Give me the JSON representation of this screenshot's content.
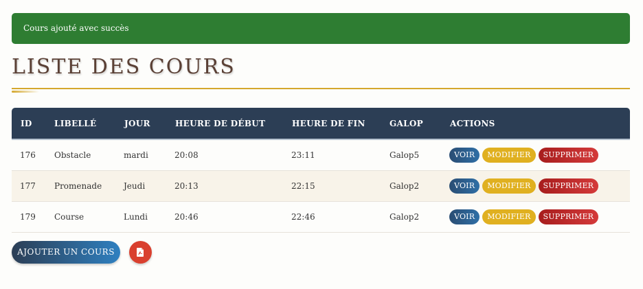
{
  "alert": {
    "message": "Cours ajouté avec succès",
    "color": "#2e7d32"
  },
  "page_title": "LISTE DES COURS",
  "table": {
    "headers": [
      "ID",
      "LIBELLÉ",
      "JOUR",
      "HEURE DE DÉBUT",
      "HEURE DE FIN",
      "GALOP",
      "ACTIONS"
    ],
    "rows": [
      {
        "id": "176",
        "libelle": "Obstacle",
        "jour": "mardi",
        "debut": "20:08",
        "fin": "23:11",
        "galop": "Galop5"
      },
      {
        "id": "177",
        "libelle": "Promenade",
        "jour": "Jeudi",
        "debut": "20:13",
        "fin": "22:15",
        "galop": "Galop2"
      },
      {
        "id": "179",
        "libelle": "Course",
        "jour": "Lundi",
        "debut": "20:46",
        "fin": "22:46",
        "galop": "Galop2"
      }
    ],
    "actions": {
      "view": "VOIR",
      "edit": "MODIFIER",
      "delete": "SUPPRIMER"
    }
  },
  "buttons": {
    "add_course": "AJOUTER UN COURS",
    "pdf_icon": "pdf-file-icon"
  },
  "colors": {
    "header_bg": "#2c3e55",
    "accent_gold": "#d4a72c",
    "view": "#2f6fa6",
    "edit": "#e0b020",
    "delete": "#c62828",
    "pdf": "#d9402f"
  }
}
